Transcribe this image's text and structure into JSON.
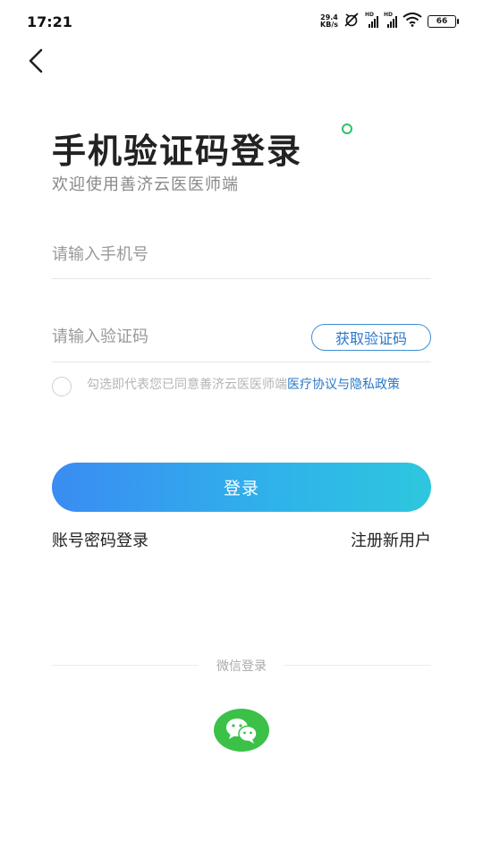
{
  "status_bar": {
    "time": "17:21",
    "net_speed_value": "29.4",
    "net_speed_unit": "KB/s",
    "hd_label": "HD",
    "battery": "66"
  },
  "header": {
    "title": "手机验证码登录",
    "subtitle": "欢迎使用善济云医医师端"
  },
  "form": {
    "phone_placeholder": "请输入手机号",
    "code_placeholder": "请输入验证码",
    "get_code_label": "获取验证码"
  },
  "agreement": {
    "prefix": "勾选即代表您已同意善济云医医师端",
    "link": "医疗协议与隐私政策",
    "checked": false
  },
  "actions": {
    "login_label": "登录",
    "password_login": "账号密码登录",
    "register": "注册新用户"
  },
  "third_party": {
    "divider_label": "微信登录",
    "icon": "wechat-icon"
  },
  "colors": {
    "accent_blue": "#2a78c7",
    "gradient_start": "#3a8cf2",
    "gradient_end": "#2ec7dd",
    "wechat_green": "#3bc148",
    "title_dot_green": "#2fc06a"
  }
}
